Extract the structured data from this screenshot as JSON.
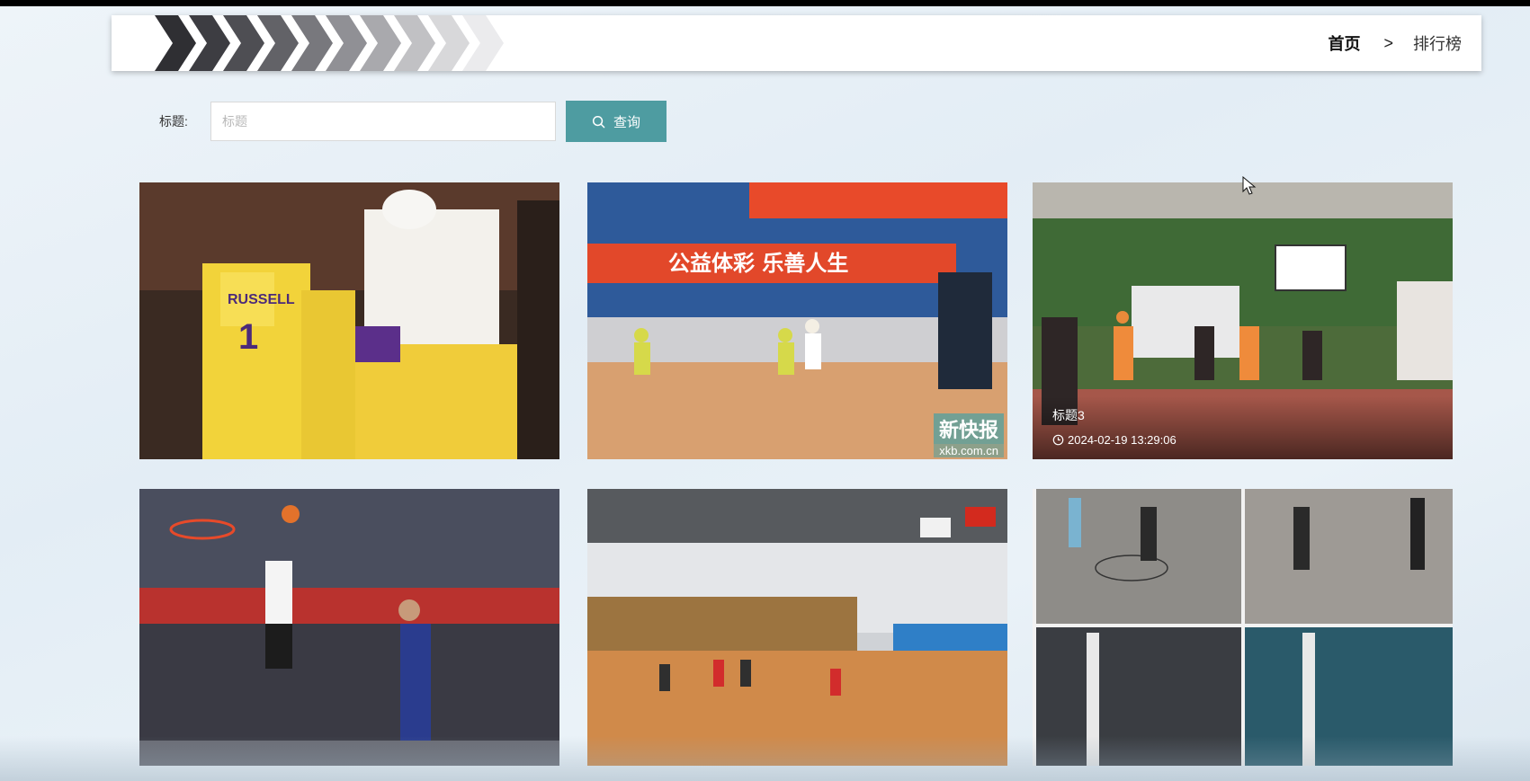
{
  "breadcrumb": {
    "home": "首页",
    "separator": ">",
    "current": "排行榜"
  },
  "search": {
    "label": "标题:",
    "placeholder": "标题",
    "value": "",
    "button_label": "查询"
  },
  "cards": [
    {
      "title": "",
      "time": "",
      "image": "lakers-players-bench"
    },
    {
      "title": "",
      "time": "",
      "image": "youth-basketball-arena",
      "banner_text": "公益体彩 乐善人生",
      "watermark": "新快报",
      "watermark_url": "xkb.com.cn"
    },
    {
      "title": "标题3",
      "time": "2024-02-19 13:29:06",
      "image": "outdoor-basketball-court"
    },
    {
      "title": "",
      "time": "",
      "image": "dunk-arena"
    },
    {
      "title": "",
      "time": "",
      "image": "indoor-gym-wood-floor"
    },
    {
      "title": "",
      "time": "",
      "image": "collage-four-games"
    }
  ],
  "colors": {
    "accent": "#4e9ca1",
    "header_bg": "#ffffff",
    "page_bg": "#e6eef5"
  },
  "icons": {
    "search": "search-icon",
    "clock": "clock-icon",
    "decor": "chevron-arrows-decor"
  }
}
